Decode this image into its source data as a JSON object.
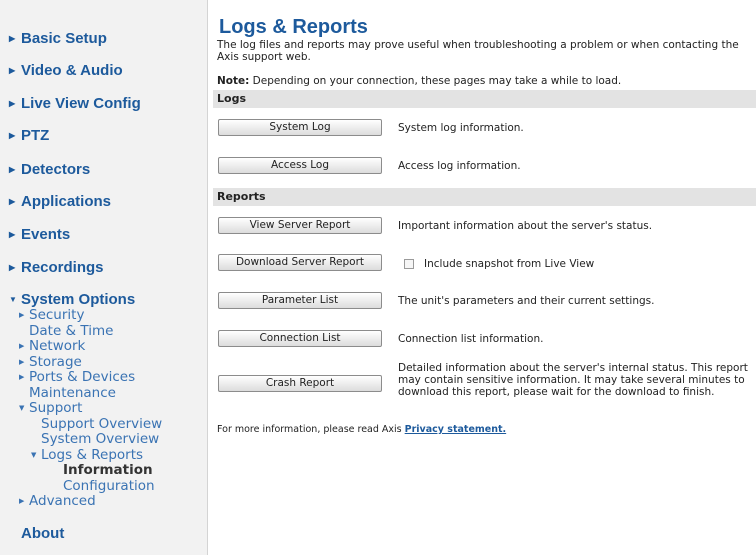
{
  "sidebar": {
    "items": [
      {
        "label": "Basic Setup"
      },
      {
        "label": "Video & Audio"
      },
      {
        "label": "Live View Config"
      },
      {
        "label": "PTZ"
      },
      {
        "label": "Detectors"
      },
      {
        "label": "Applications"
      },
      {
        "label": "Events"
      },
      {
        "label": "Recordings"
      },
      {
        "label": "System Options"
      },
      {
        "label": "About"
      }
    ],
    "system_options": {
      "security": "Security",
      "date_time": "Date & Time",
      "network": "Network",
      "storage": "Storage",
      "ports_devices": "Ports & Devices",
      "maintenance": "Maintenance",
      "support": "Support",
      "support_overview": "Support Overview",
      "system_overview": "System Overview",
      "logs_reports": "Logs & Reports",
      "information": "Information",
      "configuration": "Configuration",
      "advanced": "Advanced"
    }
  },
  "main": {
    "title": "Logs & Reports",
    "intro": "The log files and reports may prove useful when troubleshooting a problem or when contacting the Axis support web.",
    "note_label": "Note:",
    "note_text": " Depending on your connection, these pages may take a while to load.",
    "logs_header": "Logs",
    "reports_header": "Reports",
    "system_log_button": "System Log",
    "system_log_desc": "System log information.",
    "access_log_button": "Access Log",
    "access_log_desc": "Access log information.",
    "view_server_report_button": "View Server Report",
    "view_server_report_desc": "Important information about the server's status.",
    "download_server_report_button": "Download Server Report",
    "snapshot_label": "Include snapshot from Live View",
    "snapshot_checked": false,
    "parameter_list_button": "Parameter List",
    "parameter_list_desc": "The unit's parameters and their current settings.",
    "connection_list_button": "Connection List",
    "connection_list_desc": "Connection list information.",
    "crash_report_button": "Crash Report",
    "crash_report_desc": "Detailed information about the server's internal status. This report may contain sensitive information. It may take several minutes to download this report, please wait for the download to finish.",
    "footer_text": "For more information, please read Axis ",
    "footer_link": "Privacy statement."
  }
}
